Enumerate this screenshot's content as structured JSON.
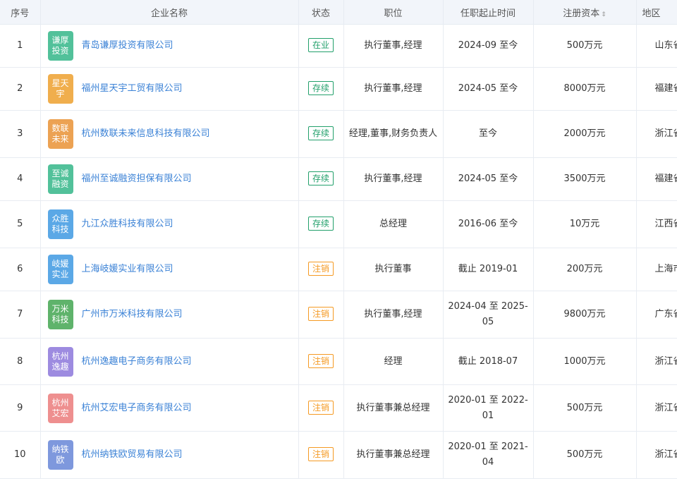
{
  "headers": {
    "index": "序号",
    "company": "企业名称",
    "status": "状态",
    "position": "职位",
    "tenure": "任职起止时间",
    "capital": "注册资本",
    "region": "地区"
  },
  "status_colors": {
    "在业": "#22a06b",
    "存续": "#22a06b",
    "注销": "#f59a23"
  },
  "rows": [
    {
      "index": "1",
      "logo": "谦厚投资",
      "logo_color": "#52c19a",
      "name": "青岛谦厚投资有限公司",
      "status": "在业",
      "position": "执行董事,经理",
      "tenure": "2024-09 至今",
      "capital": "500万元",
      "region": "山东省"
    },
    {
      "index": "2",
      "logo": "星天宇",
      "logo_color": "#f0ae4d",
      "name": "福州星天宇工贸有限公司",
      "status": "存续",
      "position": "执行董事,经理",
      "tenure": "2024-05 至今",
      "capital": "8000万元",
      "region": "福建省"
    },
    {
      "index": "3",
      "logo": "数联未来",
      "logo_color": "#eca253",
      "name": "杭州数联未来信息科技有限公司",
      "status": "存续",
      "position": "经理,董事,财务负责人",
      "tenure": "至今",
      "capital": "2000万元",
      "region": "浙江省"
    },
    {
      "index": "4",
      "logo": "至诚融资",
      "logo_color": "#52c19a",
      "name": "福州至诚融资担保有限公司",
      "status": "存续",
      "position": "执行董事,经理",
      "tenure": "2024-05 至今",
      "capital": "3500万元",
      "region": "福建省"
    },
    {
      "index": "5",
      "logo": "众胜科技",
      "logo_color": "#5ba8e6",
      "name": "九江众胜科技有限公司",
      "status": "存续",
      "position": "总经理",
      "tenure": "2016-06 至今",
      "capital": "10万元",
      "region": "江西省"
    },
    {
      "index": "6",
      "logo": "岐媛实业",
      "logo_color": "#5ba8e6",
      "name": "上海岐媛实业有限公司",
      "status": "注销",
      "position": "执行董事",
      "tenure": "截止 2019-01",
      "capital": "200万元",
      "region": "上海市"
    },
    {
      "index": "7",
      "logo": "万米科技",
      "logo_color": "#5fb36b",
      "name": "广州市万米科技有限公司",
      "status": "注销",
      "position": "执行董事,经理",
      "tenure": "2024-04 至 2025-05",
      "capital": "9800万元",
      "region": "广东省"
    },
    {
      "index": "8",
      "logo": "杭州逸趣",
      "logo_color": "#9d8be0",
      "name": "杭州逸趣电子商务有限公司",
      "status": "注销",
      "position": "经理",
      "tenure": "截止 2018-07",
      "capital": "1000万元",
      "region": "浙江省"
    },
    {
      "index": "9",
      "logo": "杭州艾宏",
      "logo_color": "#ee8f8f",
      "name": "杭州艾宏电子商务有限公司",
      "status": "注销",
      "position": "执行董事兼总经理",
      "tenure": "2020-01 至 2022-01",
      "capital": "500万元",
      "region": "浙江省"
    },
    {
      "index": "10",
      "logo": "纳铁欧",
      "logo_color": "#7e98dd",
      "name": "杭州纳铁欧贸易有限公司",
      "status": "注销",
      "position": "执行董事兼总经理",
      "tenure": "2020-01 至 2021-04",
      "capital": "500万元",
      "region": "浙江省"
    }
  ]
}
